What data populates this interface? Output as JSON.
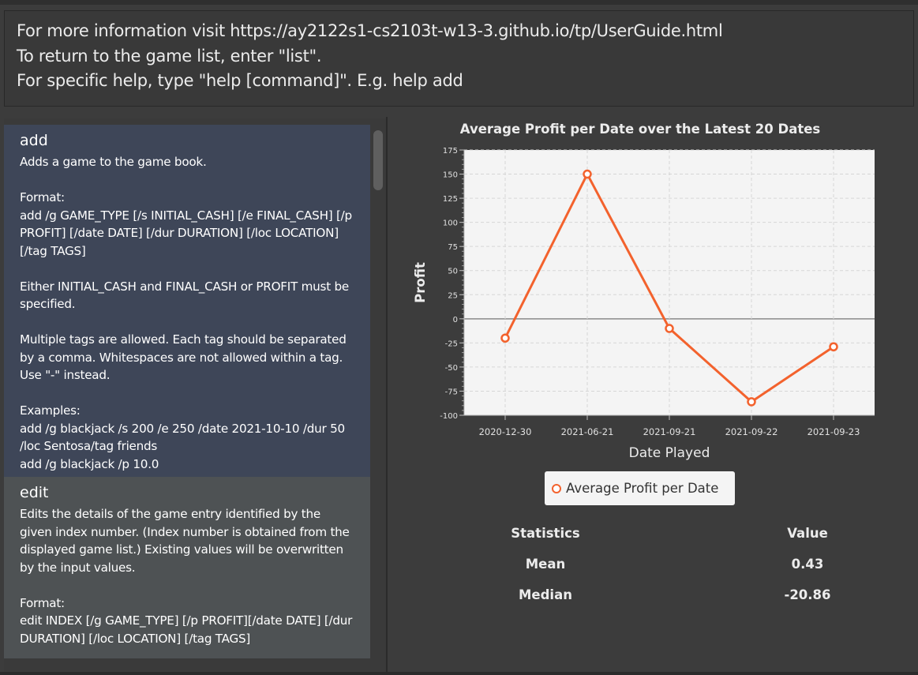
{
  "result_display": {
    "lines": [
      "For more information visit https://ay2122s1-cs2103t-w13-3.github.io/tp/UserGuide.html",
      "To return to the game list, enter \"list\".",
      "For specific help, type \"help [command]\". E.g. help add"
    ]
  },
  "help_list": {
    "items": [
      {
        "title": "add",
        "body": "Adds a game to the game book.\n\nFormat:\nadd /g GAME_TYPE [/s INITIAL_CASH] [/e FINAL_CASH] [/p PROFIT] [/date DATE] [/dur DURATION] [/loc LOCATION] [/tag TAGS]\n\nEither INITIAL_CASH and FINAL_CASH or PROFIT must be specified.\n\nMultiple tags are allowed. Each tag should be separated by a comma. Whitespaces are not allowed within a tag. Use \"-\" instead.\n\nExamples:\nadd /g blackjack /s 200 /e 250 /date 2021-10-10 /dur 50 /loc Sentosa/tag friends\nadd /g blackjack /p 10.0",
        "selected": true
      },
      {
        "title": "edit",
        "body": "Edits the details of the game entry identified by the given index number. (Index number is obtained from the displayed game list.) Existing values will be overwritten by the input values.\n\nFormat:\nedit INDEX [/g GAME_TYPE] [/p PROFIT][/date DATE] [/dur DURATION] [/loc LOCATION] [/tag TAGS]",
        "selected": false
      }
    ]
  },
  "chart_data": {
    "type": "line",
    "title": "Average Profit per Date over the Latest 20 Dates",
    "xlabel": "Date Played",
    "ylabel": "Profit",
    "categories": [
      "2020-12-30",
      "2021-06-21",
      "2021-09-21",
      "2021-09-22",
      "2021-09-23"
    ],
    "series": [
      {
        "name": "Average Profit per Date",
        "values": [
          -20,
          150,
          -10,
          -86,
          -29
        ],
        "color": "#f3622d"
      }
    ],
    "ylim": [
      -100,
      175
    ],
    "yticks": [
      -100,
      -75,
      -50,
      -25,
      0,
      25,
      50,
      75,
      100,
      125,
      150,
      175
    ],
    "grid": true,
    "legend_position": "bottom"
  },
  "statistics": {
    "header": {
      "name": "Statistics",
      "value": "Value"
    },
    "rows": [
      {
        "name": "Mean",
        "value": "0.43"
      },
      {
        "name": "Median",
        "value": "-20.86"
      }
    ]
  }
}
